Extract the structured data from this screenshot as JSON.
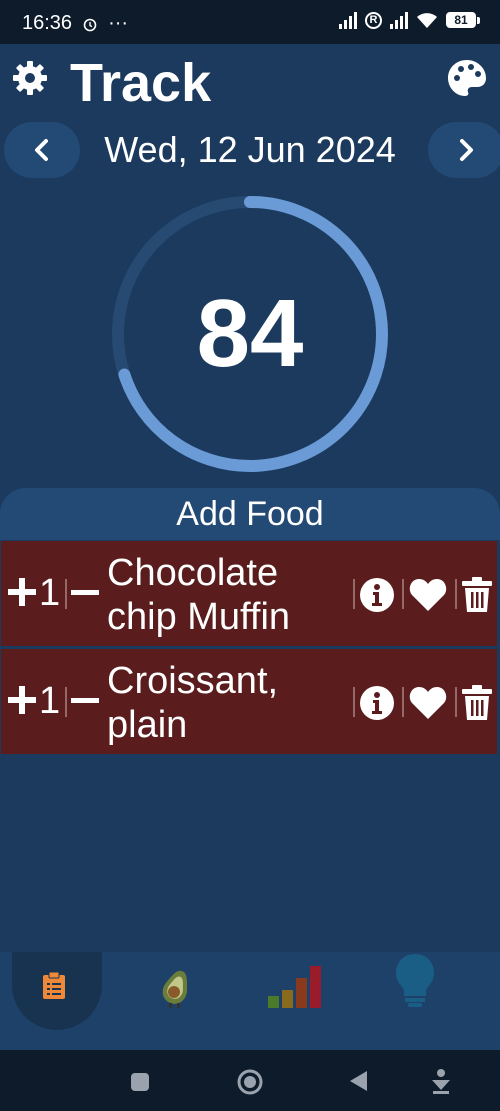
{
  "status_bar": {
    "time": "16:36",
    "dots": "···",
    "battery": "81",
    "r_badge": "R"
  },
  "header": {
    "title": "Track",
    "settings_icon": "gear-icon",
    "theme_icon": "palette-icon"
  },
  "date_nav": {
    "date": "Wed, 12 Jun 2024",
    "prev_icon": "chevron-left-icon",
    "next_icon": "chevron-right-icon"
  },
  "progress": {
    "value": "84",
    "fraction_filled": 0.7,
    "ring_color": "#6b9bd6",
    "track_color": "#264a72"
  },
  "add_food": {
    "label": "Add Food"
  },
  "foods": [
    {
      "plus": "+",
      "qty": "1",
      "name": "Chocolate chip Muffin"
    },
    {
      "plus": "+",
      "qty": "1",
      "name": "Croissant, plain"
    }
  ],
  "bottom_nav": [
    {
      "icon": "clipboard-icon",
      "active": true
    },
    {
      "icon": "avocado-icon",
      "active": false
    },
    {
      "icon": "bar-chart-icon",
      "active": false
    },
    {
      "icon": "lightbulb-icon",
      "active": false
    }
  ],
  "system_nav": [
    "square-icon",
    "home-circle-icon",
    "back-triangle-icon",
    "download-icon"
  ],
  "colors": {
    "background": "#1b3a5e",
    "row": "#5a1c1c",
    "accent_orange": "#f0883a"
  }
}
